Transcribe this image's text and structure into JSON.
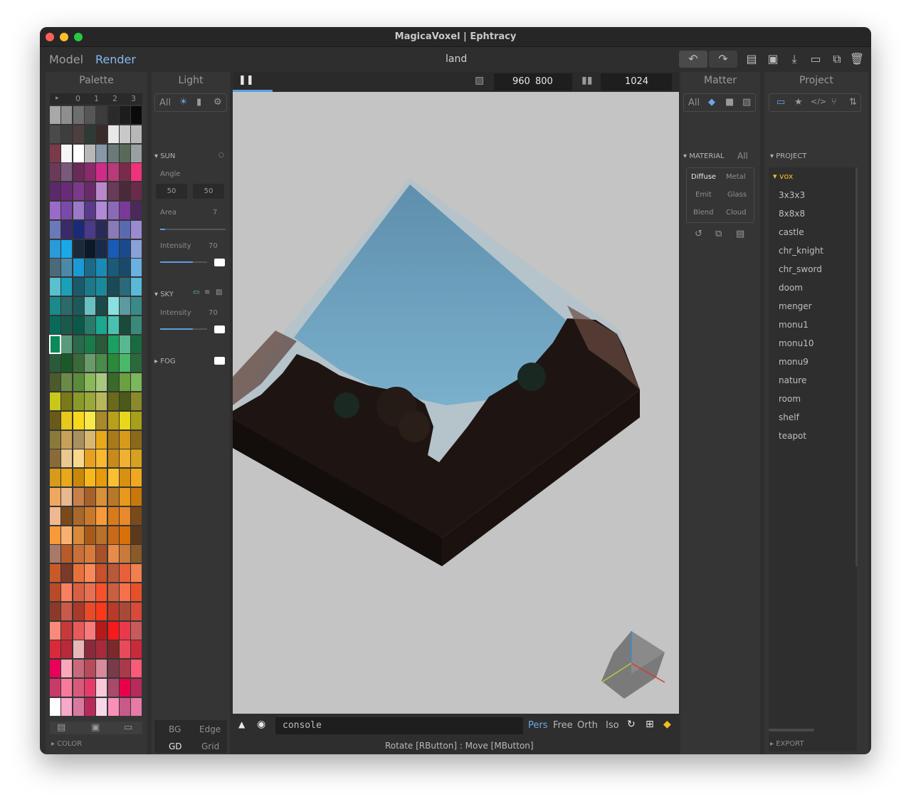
{
  "window": {
    "title": "MagicaVoxel | Ephtracy"
  },
  "menu": {
    "model": "Model",
    "render": "Render",
    "file_name": "land"
  },
  "toolbar": {
    "undo": "↶",
    "redo": "↷",
    "open": "▤",
    "save": "▣",
    "export": "⤓",
    "new": "▭",
    "copy": "⧉",
    "delete": "🗑"
  },
  "palette": {
    "title": "Palette",
    "tabs": [
      "▸",
      "0",
      "1",
      "2",
      "3"
    ],
    "footer_label": "COLOR",
    "colors": [
      [
        "#a8a8a8",
        "#8e8e8e",
        "#6e6e6e",
        "#565656",
        "#3c3c3c",
        "#2a2a2a",
        "#1c1c1c",
        "#0a0a0a"
      ],
      [
        "#4a4a4a",
        "#3e3e3e",
        "#4e3f3f",
        "#2e3a34",
        "#3a2a2a",
        "#e8e8e8",
        "#c8c8c8",
        "#b8b8b8"
      ],
      [
        "#7a3a4a",
        "#f6f6f6",
        "#ffffff",
        "#b8b8b8",
        "#8898a8",
        "#6a7a78",
        "#5a6a5a",
        "#9aa0a0"
      ],
      [
        "#6a3a5a",
        "#7a5a7a",
        "#6a2a5a",
        "#8a2a6a",
        "#d22a8a",
        "#b83a7a",
        "#7a2a4a",
        "#f0327a"
      ],
      [
        "#5a2a6a",
        "#6a2a7a",
        "#7a3a8a",
        "#6a2a6a",
        "#b888c8",
        "#6a3a5a",
        "#4a2a3a",
        "#6a2a4a"
      ],
      [
        "#9a6ac8",
        "#7a4aa8",
        "#9a7ac8",
        "#5a3a8a",
        "#b08ad8",
        "#8a6ab8",
        "#7a3a9a",
        "#4a2a5a"
      ],
      [
        "#6a7ab8",
        "#3a2a6a",
        "#1a2a7a",
        "#4a3a8a",
        "#2a2a5a",
        "#8a7ab8",
        "#5a6ab0",
        "#9a8ad0"
      ],
      [
        "#2a9ad8",
        "#1aa8e8",
        "#1a2a3a",
        "#0a1a2a",
        "#1a2a4a",
        "#1a5ab8",
        "#1a4a8a",
        "#8aa0d8"
      ],
      [
        "#4a6a7a",
        "#4a8aa8",
        "#1a9ad8",
        "#1a6a8a",
        "#1a8ab8",
        "#1a5a7a",
        "#1a4a6a",
        "#6ab0e0"
      ],
      [
        "#5ac0d0",
        "#1aa0b8",
        "#1a5a6a",
        "#1a7a8a",
        "#1a8a9a",
        "#1a4a5a",
        "#2a6a7a",
        "#5ab8d8"
      ],
      [
        "#1a8a8a",
        "#2a6a6a",
        "#1a5a5a",
        "#6ac0c0",
        "#1a4a4a",
        "#8ae0e0",
        "#5a9aa0",
        "#3a8a8a"
      ],
      [
        "#0a6a5a",
        "#1a5a4a",
        "#0a5a4a",
        "#2a7a6a",
        "#1aa890",
        "#4ac0b0",
        "#1a4a3a",
        "#3a8a7a"
      ],
      [
        "#0a8a5a",
        "#5a9a7a",
        "#2a6a4a",
        "#1a7a4a",
        "#2a5a3a",
        "#1aa060",
        "#5ab890",
        "#1a6a40"
      ],
      [
        "#2a5a3a",
        "#1a5a2a",
        "#3a6a3a",
        "#6a9a6a",
        "#4a8a4a",
        "#2a8a3a",
        "#4ab86a",
        "#2a6a3a"
      ],
      [
        "#4a5a2a",
        "#6a8a4a",
        "#5a8a3a",
        "#8ab85a",
        "#a8c880",
        "#3a6a2a",
        "#6aa040",
        "#7ab85a"
      ],
      [
        "#c8c81a",
        "#7a7a1a",
        "#8a9a2a",
        "#9aa83a",
        "#b8b85a",
        "#6a6a1a",
        "#4a5a1a",
        "#8a8a2a"
      ],
      [
        "#6a5a1a",
        "#e8c81a",
        "#f8d81a",
        "#f8e84a",
        "#a88a2a",
        "#b8a01a",
        "#e8d81a",
        "#a8a01a"
      ],
      [
        "#8a7a3a",
        "#c8a05a",
        "#a89060",
        "#d8b870",
        "#e8a81a",
        "#a87a1a",
        "#d89a1a",
        "#8a6a1a"
      ],
      [
        "#8a6a3a",
        "#e8c890",
        "#f8d88a",
        "#e8a020",
        "#f8b830",
        "#c88a1a",
        "#f0b030",
        "#d8a020"
      ],
      [
        "#d89a1a",
        "#e8a81a",
        "#c8880a",
        "#f8b81a",
        "#e89a0a",
        "#f8c030",
        "#d89010",
        "#f0a820"
      ],
      [
        "#f0a860",
        "#e8b890",
        "#c8804a",
        "#a8602a",
        "#d8903a",
        "#b8782a",
        "#e8981a",
        "#c8780a"
      ],
      [
        "#f0b890",
        "#7a4a1a",
        "#a8682a",
        "#c8782a",
        "#f89a3a",
        "#d87a1a",
        "#e88a2a",
        "#7a4a1a"
      ],
      [
        "#f89a3a",
        "#f8b070",
        "#d88a3a",
        "#a85a1a",
        "#b8702a",
        "#c86a1a",
        "#d8700a",
        "#5a3a1a"
      ],
      [
        "#a87a6a",
        "#b85a2a",
        "#c8703a",
        "#d87a3a",
        "#a8502a",
        "#e88a4a",
        "#c87a3a",
        "#8a5a2a"
      ],
      [
        "#c85a2a",
        "#7a3a2a",
        "#e8703a",
        "#f88a5a",
        "#c8502a",
        "#b85a3a",
        "#e8603a",
        "#f08050"
      ],
      [
        "#b84a2a",
        "#f88060",
        "#d86040",
        "#e87050",
        "#f8502a",
        "#c86040",
        "#f8704a",
        "#e8502a"
      ],
      [
        "#8a3a2a",
        "#c85a4a",
        "#a83a2a",
        "#e84a2a",
        "#f83a1a",
        "#b83a2a",
        "#a84a3a",
        "#d84a3a"
      ],
      [
        "#f88a7a",
        "#c83a3a",
        "#e85a5a",
        "#f87a7a",
        "#b81a1a",
        "#f81a1a",
        "#e83a4a",
        "#c85a5a"
      ],
      [
        "#d82a3a",
        "#b82a3a",
        "#e8b8b8",
        "#8a2a3a",
        "#a82a3a",
        "#7a2a2a",
        "#e84a5a",
        "#c82a3a"
      ],
      [
        "#e8005a",
        "#f8a8b8",
        "#c86a7a",
        "#b84a5a",
        "#d88a9a",
        "#7a3a4a",
        "#a83a4a",
        "#f85a7a"
      ],
      [
        "#c83a6a",
        "#f87a9a",
        "#d85a7a",
        "#e83a6a",
        "#f8c8d8",
        "#a84a6a",
        "#e8004a",
        "#b82a5a"
      ],
      [
        "#ffffff",
        "#f8a8c8",
        "#d87aa0",
        "#b82a5a",
        "#f8d8e8",
        "#f890b8",
        "#c85a8a",
        "#e87aa8"
      ]
    ]
  },
  "light": {
    "title": "Light",
    "filter_all": "All",
    "sun": {
      "label": "SUN",
      "angle_label": "Angle",
      "angle_1": "50",
      "angle_2": "50",
      "area_label": "Area",
      "area_value": "7",
      "area_fill": 0.08,
      "intensity_label": "Intensity",
      "intensity_value": "70",
      "intensity_fill": 0.7
    },
    "sky": {
      "label": "SKY",
      "intensity_label": "Intensity",
      "intensity_value": "70",
      "intensity_fill": 0.7
    },
    "fog": {
      "label": "FOG"
    },
    "bottom": {
      "bg": "BG",
      "edge": "Edge",
      "gd": "GD",
      "grid": "Grid"
    }
  },
  "render": {
    "width": "960",
    "height": "800",
    "samples": "1024",
    "progress": 0.09,
    "view_modes": [
      "Pers",
      "Free",
      "Orth",
      "Iso"
    ],
    "console_placeholder": "console",
    "status": "Rotate [RButton] : Move [MButton]"
  },
  "matter": {
    "title": "Matter",
    "filter_all": "All",
    "material_label": "MATERIAL",
    "material_all": "All",
    "materials": [
      "Diffuse",
      "Metal",
      "Emit",
      "Glass",
      "Blend",
      "Cloud"
    ]
  },
  "project": {
    "title": "Project",
    "section_label": "PROJECT",
    "folder": "vox",
    "items": [
      "3x3x3",
      "8x8x8",
      "castle",
      "chr_knight",
      "chr_sword",
      "doom",
      "menger",
      "monu1",
      "monu10",
      "monu9",
      "nature",
      "room",
      "shelf",
      "teapot"
    ],
    "footer_label": "EXPORT"
  },
  "colors": {
    "accent": "#5a9ee0",
    "selected_folder": "#f0c020",
    "window_bg": "#2e2e2e",
    "panel_bg": "#353535",
    "viewport_bg": "#c4c4c4"
  }
}
